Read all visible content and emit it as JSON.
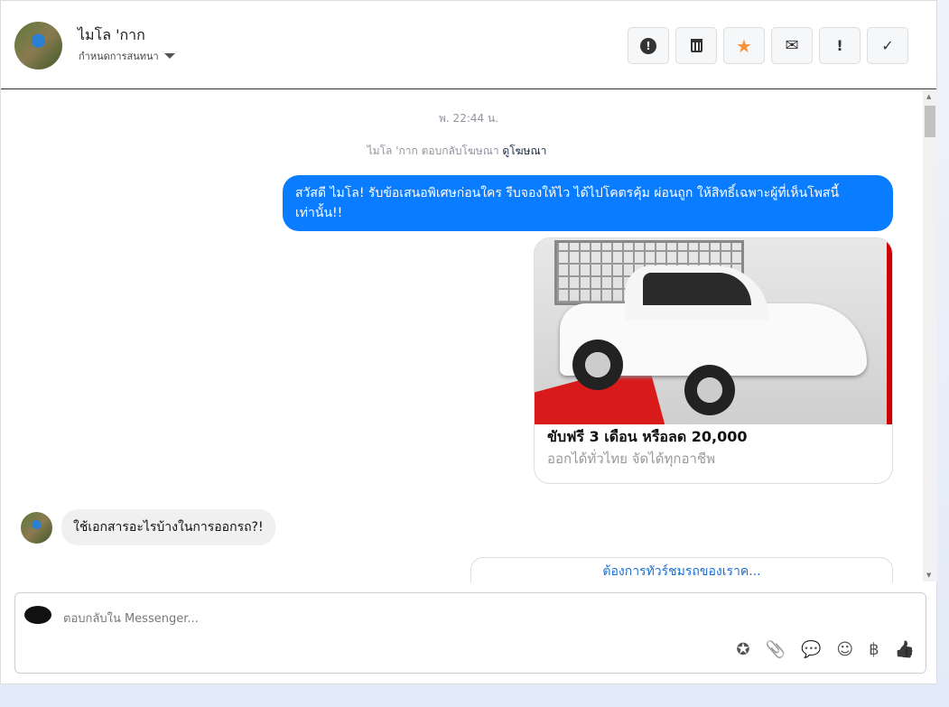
{
  "header": {
    "name": "ไมโล 'กาก",
    "subtitle": "กำหนดการสนทนา"
  },
  "toolbar": [
    {
      "name": "spam-button",
      "icon": "⬤!",
      "label": "❗"
    },
    {
      "name": "delete-button",
      "label": "🗑"
    },
    {
      "name": "star-button",
      "label": "★"
    },
    {
      "name": "mark-unread-button",
      "label": "✉"
    },
    {
      "name": "important-button",
      "label": "!"
    },
    {
      "name": "done-button",
      "label": "✓"
    }
  ],
  "conversation": {
    "timestamp": "พ. 22:44 น.",
    "reply_note": "ไมโล 'กาก ตอบกลับโฆษณา",
    "view_ad_link": "ดูโฆษณา",
    "outgoing_message": "สวัสดี ไมโล! รับข้อเสนอพิเศษก่อนใคร รีบจองให้ไว ได้ไปโคตรคุ้ม ผ่อนถูก ให้สิทธิ์เฉพาะผู้ที่เห็นโพสนี้เท่านั้น!!",
    "card_title": "ขับฟรี 3 เดือน หรือลด 20,000",
    "card_description": "ออกได้ทั่วไทย จัดได้ทุกอาชีพ",
    "incoming_message": "ใช้เอกสารอะไรบ้างในการออกรถ?!",
    "quick_reply": "ต้องการทัวร์ชมรถของเราค..."
  },
  "composer": {
    "placeholder": "ตอบกลับใน Messenger..."
  },
  "composer_icons": [
    "saved-reply-icon",
    "attachment-icon",
    "chat-icon",
    "emoji-icon",
    "baht-icon",
    "thumbs-up-icon"
  ],
  "composer_glyphs": {
    "saved": "✪",
    "attach": "📎",
    "chat": "💬",
    "emoji": "☺",
    "baht": "฿",
    "like": "👍"
  },
  "colors": {
    "accent": "#0a7cff",
    "star": "#f5923e"
  }
}
